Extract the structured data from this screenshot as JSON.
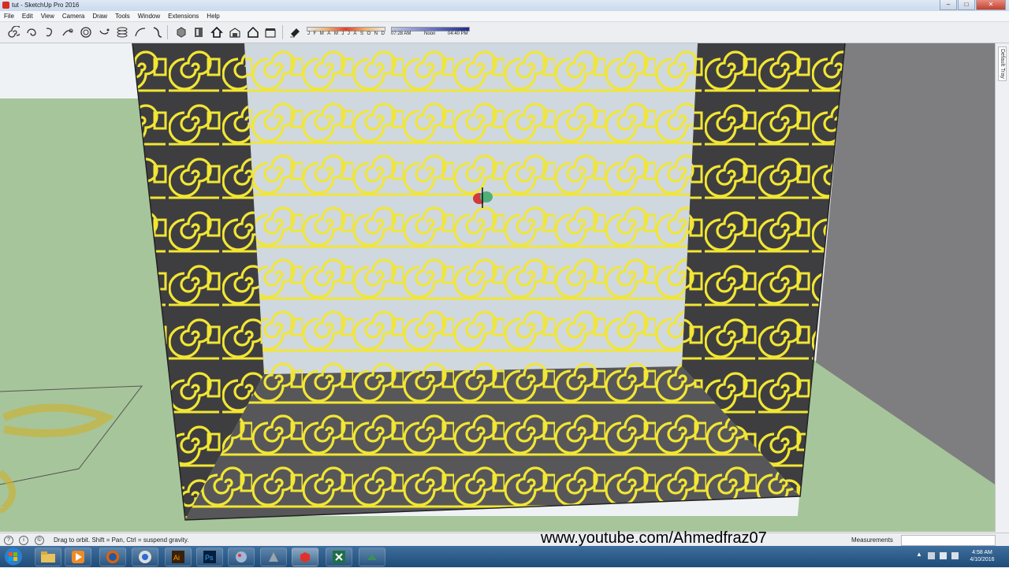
{
  "window": {
    "title": "tut - SketchUp Pro 2016",
    "min": "–",
    "max": "□",
    "close": "✕"
  },
  "menu": [
    "File",
    "Edit",
    "View",
    "Camera",
    "Draw",
    "Tools",
    "Window",
    "Extensions",
    "Help"
  ],
  "toolbar": {
    "icons": [
      "spiral-tool-1-icon",
      "spiral-tool-2-icon",
      "spiral-tool-3-icon",
      "curve-tool-icon",
      "circle-spiral-icon",
      "arc-spiral-icon",
      "helix-icon",
      "arc-icon",
      "hook-icon",
      "component-tool-icon",
      "section-tool-icon",
      "home-view-icon",
      "house-icon",
      "warehouse-icon",
      "shadow-toggle-icon"
    ],
    "months": [
      "J",
      "F",
      "M",
      "A",
      "M",
      "J",
      "J",
      "A",
      "S",
      "O",
      "N",
      "D"
    ],
    "time_start": "07:28 AM",
    "time_noon": "Noon",
    "time_end": "04:40 PM"
  },
  "tray": {
    "label": "Default Tray"
  },
  "status": {
    "hint": "Drag to orbit. Shift = Pan, Ctrl = suspend gravity.",
    "watermark": "www.youtube.com/Ahmedfraz07",
    "measurements_label": "Measurements",
    "measurements_value": ""
  },
  "taskbar": {
    "apps": [
      "explorer",
      "media-player",
      "firefox",
      "chrome-like",
      "illustrator",
      "photoshop",
      "paint",
      "rhino",
      "sketchup",
      "excel",
      "other"
    ],
    "ai_label": "Ai",
    "ps_label": "Ps",
    "time": "4:58 AM",
    "date": "4/10/2016"
  },
  "colors": {
    "ornament": "#f2e633",
    "panel_dark": "#3e3e40",
    "floor_green": "#a7c59a",
    "sky": "#eef2f4"
  }
}
